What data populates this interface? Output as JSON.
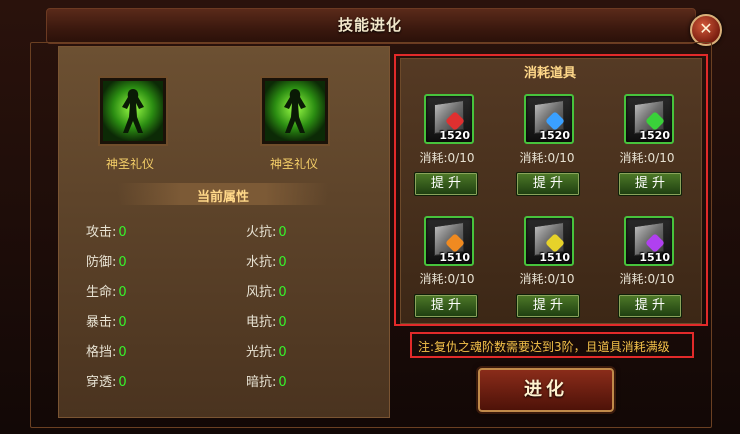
{
  "window": {
    "title": "技能进化",
    "close_glyph": "✕"
  },
  "skill": {
    "current_label": "神圣礼仪",
    "next_label": "神圣礼仪",
    "icon_name": "green-silhouette-skill-icon"
  },
  "attributes": {
    "title": "当前属性",
    "items": [
      {
        "label": "攻击:",
        "value": "0"
      },
      {
        "label": "火抗:",
        "value": "0"
      },
      {
        "label": "防御:",
        "value": "0"
      },
      {
        "label": "水抗:",
        "value": "0"
      },
      {
        "label": "生命:",
        "value": "0"
      },
      {
        "label": "风抗:",
        "value": "0"
      },
      {
        "label": "暴击:",
        "value": "0"
      },
      {
        "label": "电抗:",
        "value": "0"
      },
      {
        "label": "格挡:",
        "value": "0"
      },
      {
        "label": "光抗:",
        "value": "0"
      },
      {
        "label": "穿透:",
        "value": "0"
      },
      {
        "label": "暗抗:",
        "value": "0"
      }
    ]
  },
  "consumables": {
    "title": "消耗道具",
    "button_label": "提 升",
    "items": [
      {
        "count": "1520",
        "consume": "消耗:0/10",
        "gem_color": "#e03030"
      },
      {
        "count": "1520",
        "consume": "消耗:0/10",
        "gem_color": "#3aa0ff"
      },
      {
        "count": "1520",
        "consume": "消耗:0/10",
        "gem_color": "#3ad13a"
      },
      {
        "count": "1510",
        "consume": "消耗:0/10",
        "gem_color": "#f08a20"
      },
      {
        "count": "1510",
        "consume": "消耗:0/10",
        "gem_color": "#e6d22a"
      },
      {
        "count": "1510",
        "consume": "消耗:0/10",
        "gem_color": "#b040f0"
      }
    ]
  },
  "note": "注:复仇之魂阶数需要达到3阶，且道具消耗满级",
  "evolve_button": "进化",
  "colors": {
    "value_green": "#37f22c",
    "label_gold": "#f5cf68",
    "highlight_red": "#e22a2a"
  }
}
